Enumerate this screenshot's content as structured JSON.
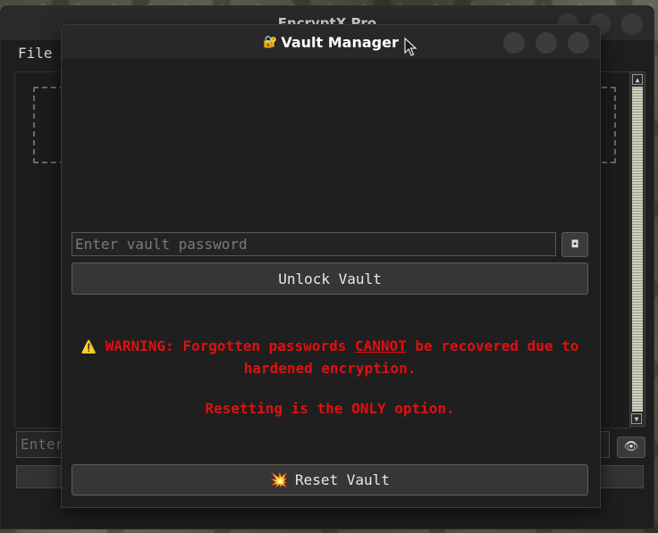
{
  "back_window": {
    "title": "EncryptX Pro",
    "menu": [
      "File"
    ],
    "input_placeholder": "Enter",
    "eye_icon": "eye-icon"
  },
  "dialog": {
    "title": "Vault Manager",
    "title_icon": "lock-icon",
    "password": {
      "placeholder": "Enter vault password",
      "value": ""
    },
    "toggle_icon": "eye-toggle-icon",
    "unlock_label": "Unlock Vault",
    "warning": {
      "icon": "warning-icon",
      "prefix": "WARNING: Forgotten passwords ",
      "emphasis": "CANNOT",
      "suffix": " be recovered due to hardened encryption."
    },
    "reset_note": "Resetting is the ONLY option.",
    "reset_label": "Reset Vault",
    "reset_icon": "explosion-icon"
  },
  "colors": {
    "warning_text": "#e01010",
    "dialog_bg": "#1f1f1f",
    "titlebar_bg": "#282828",
    "button_bg": "#363636"
  }
}
